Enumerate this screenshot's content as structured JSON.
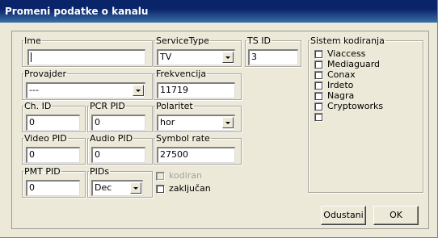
{
  "window": {
    "title": "Promeni podatke o kanalu"
  },
  "fields": {
    "ime": {
      "label": "Ime",
      "value": ""
    },
    "service_type": {
      "label": "ServiceType",
      "value": "TV"
    },
    "ts_id": {
      "label": "TS ID",
      "value": "3"
    },
    "provajder": {
      "label": "Provajder",
      "value": "---"
    },
    "frekvencija": {
      "label": "Frekvencija",
      "value": "11719"
    },
    "ch_id": {
      "label": "Ch. ID",
      "value": "0"
    },
    "pcr_pid": {
      "label": "PCR PID",
      "value": "0"
    },
    "polaritet": {
      "label": "Polaritet",
      "value": "hor"
    },
    "video_pid": {
      "label": "Video PID",
      "value": "0"
    },
    "audio_pid": {
      "label": "Audio PID",
      "value": "0"
    },
    "symbol_rate": {
      "label": "Symbol rate",
      "value": "27500"
    },
    "pmt_pid": {
      "label": "PMT PID",
      "value": "0"
    },
    "pids": {
      "label": "PIDs",
      "value": "Dec"
    }
  },
  "flags": {
    "kodiran": {
      "label": "kodiran",
      "checked": false,
      "enabled": false
    },
    "zakljucan": {
      "label": "zaključan",
      "checked": false,
      "enabled": true
    }
  },
  "sistem_kodiranja": {
    "label": "Sistem kodiranja",
    "items": [
      {
        "label": "Viaccess",
        "checked": false
      },
      {
        "label": "Mediaguard",
        "checked": false
      },
      {
        "label": "Conax",
        "checked": false
      },
      {
        "label": "Irdeto",
        "checked": false
      },
      {
        "label": "Nagra",
        "checked": false
      },
      {
        "label": "Cryptoworks",
        "checked": false
      },
      {
        "label": "",
        "checked": false
      }
    ]
  },
  "buttons": {
    "cancel": "Odustani",
    "ok": "OK"
  }
}
